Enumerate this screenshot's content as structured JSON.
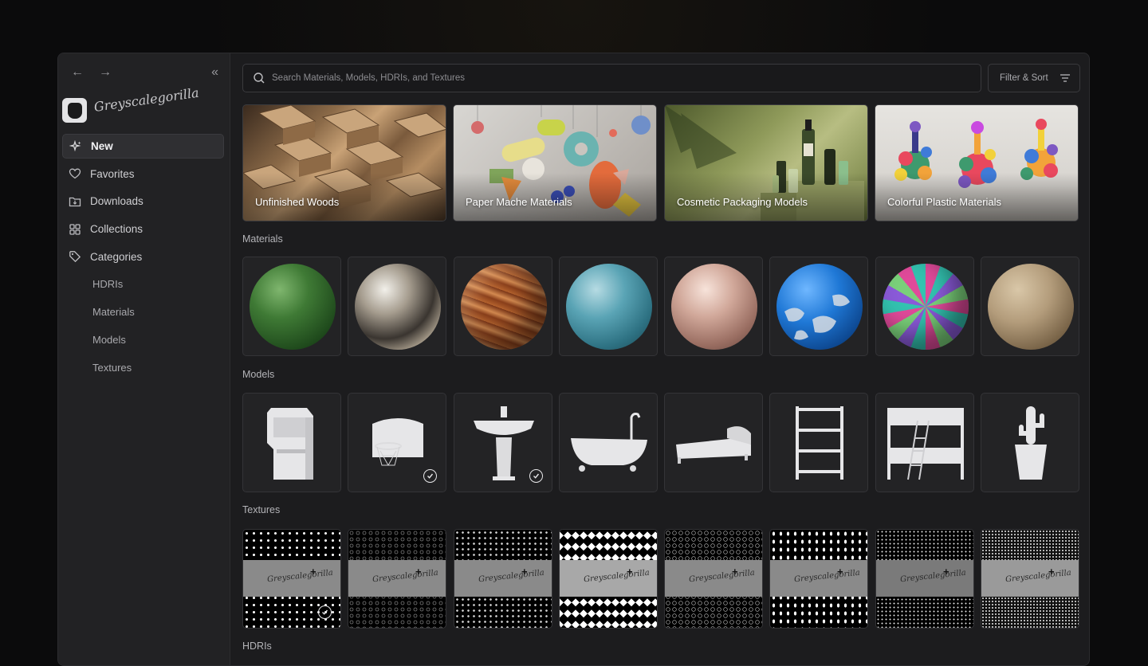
{
  "sidebar": {
    "brand": "Greyscalegorilla",
    "items": [
      {
        "label": "New",
        "icon": "sparkle-icon"
      },
      {
        "label": "Favorites",
        "icon": "heart-icon"
      },
      {
        "label": "Downloads",
        "icon": "download-folder-icon"
      },
      {
        "label": "Collections",
        "icon": "grid-icon"
      },
      {
        "label": "Categories",
        "icon": "tag-icon"
      }
    ],
    "categories": [
      "HDRIs",
      "Materials",
      "Models",
      "Textures"
    ]
  },
  "search": {
    "placeholder": "Search Materials, Models, HDRIs, and Textures"
  },
  "filter": {
    "label": "Filter & Sort"
  },
  "featured": [
    "Unfinished Woods",
    "Paper Mache Materials",
    "Cosmetic Packaging Models",
    "Colorful Plastic Materials"
  ],
  "sections": {
    "materials": "Materials",
    "models": "Models",
    "textures": "Textures",
    "hdris": "HDRIs"
  },
  "materials": [
    {
      "icon": "green-tile-sphere"
    },
    {
      "icon": "tarnished-metal-sphere"
    },
    {
      "icon": "wood-plank-sphere"
    },
    {
      "icon": "blue-tile-sphere"
    },
    {
      "icon": "rose-gold-sphere"
    },
    {
      "icon": "chipped-blue-paint-sphere"
    },
    {
      "icon": "sequin-sphere"
    },
    {
      "icon": "plaster-sphere"
    }
  ],
  "models": [
    {
      "icon": "arcade-cabinet-icon",
      "downloaded": false
    },
    {
      "icon": "basketball-hoop-icon",
      "downloaded": true
    },
    {
      "icon": "pedestal-sink-icon",
      "downloaded": true
    },
    {
      "icon": "clawfoot-bathtub-icon",
      "downloaded": false
    },
    {
      "icon": "bed-icon",
      "downloaded": false
    },
    {
      "icon": "shelf-icon",
      "downloaded": false
    },
    {
      "icon": "bunk-bed-icon",
      "downloaded": false
    },
    {
      "icon": "potted-cactus-icon",
      "downloaded": false
    }
  ],
  "textures": [
    {
      "pattern": "dots",
      "downloaded": true
    },
    {
      "pattern": "rings",
      "downloaded": false
    },
    {
      "pattern": "crosses",
      "downloaded": false
    },
    {
      "pattern": "diamonds",
      "downloaded": false
    },
    {
      "pattern": "circles",
      "downloaded": false
    },
    {
      "pattern": "drops",
      "downloaded": false
    },
    {
      "pattern": "fine-dots",
      "downloaded": false
    },
    {
      "pattern": "grain",
      "downloaded": false
    }
  ],
  "colors": {
    "accent": "#2f2f32",
    "window": "#1c1c1e",
    "sidebar": "#222224"
  }
}
